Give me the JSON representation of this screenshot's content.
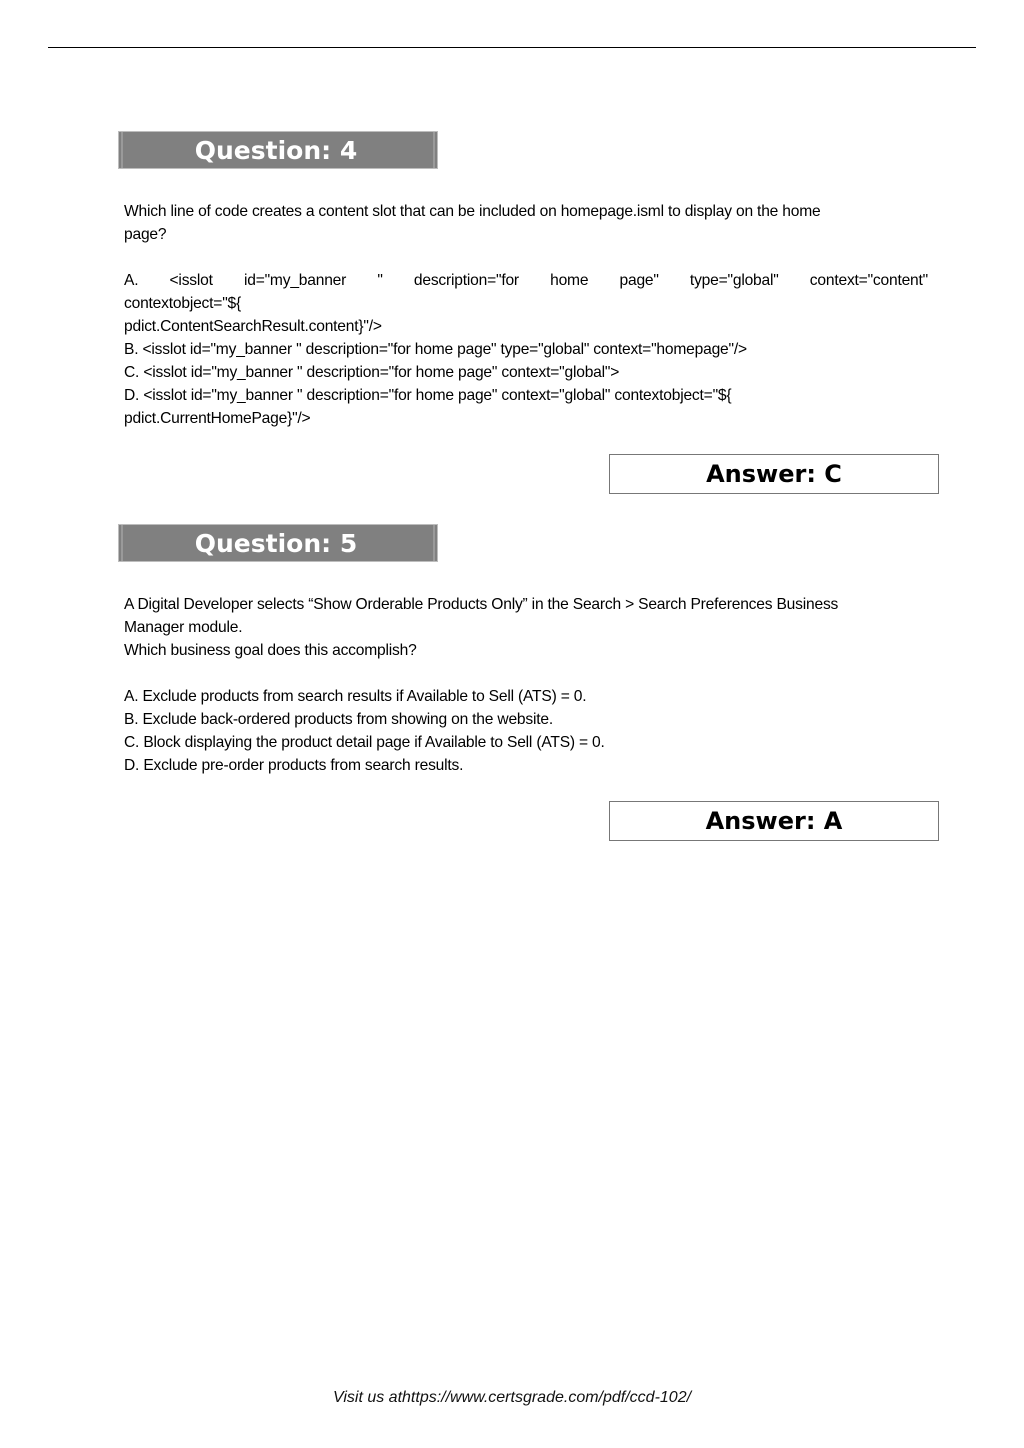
{
  "questions": [
    {
      "heading": "Question: 4",
      "prompt_lines": [
        "Which line of code creates a content slot that can be included on homepage.isml to display on the home",
        "page?"
      ],
      "options": [
        "A. <isslot id=\"my_banner \" description=\"for home page\" type=\"global\" context=\"content\"",
        "contextobject=\"${",
        "pdict.ContentSearchResult.content}\"/>",
        "B. <isslot id=\"my_banner \" description=\"for home page\" type=\"global\" context=\"homepage\"/>",
        "C. <isslot id=\"my_banner \" description=\"for home page\" context=\"global\">",
        "D. <isslot id=\"my_banner \" description=\"for home page\" context=\"global\" contextobject=\"${",
        "pdict.CurrentHomePage}\"/>"
      ],
      "answer": "Answer: C"
    },
    {
      "heading": "Question: 5",
      "prompt_lines": [
        "A Digital Developer selects “Show Orderable Products Only” in the Search > Search Preferences Business",
        "Manager module.",
        "Which business goal does this accomplish?"
      ],
      "options": [
        "A. Exclude products from search results if Available to Sell (ATS) = 0.",
        "B. Exclude back-ordered products from showing on the website.",
        "C. Block displaying the product detail page if Available to Sell (ATS) = 0.",
        "D. Exclude pre-order products from search results."
      ],
      "answer": "Answer: A"
    }
  ],
  "footer": {
    "text": "Visit us athttps://www.certsgrade.com/pdf/ccd-102/"
  }
}
